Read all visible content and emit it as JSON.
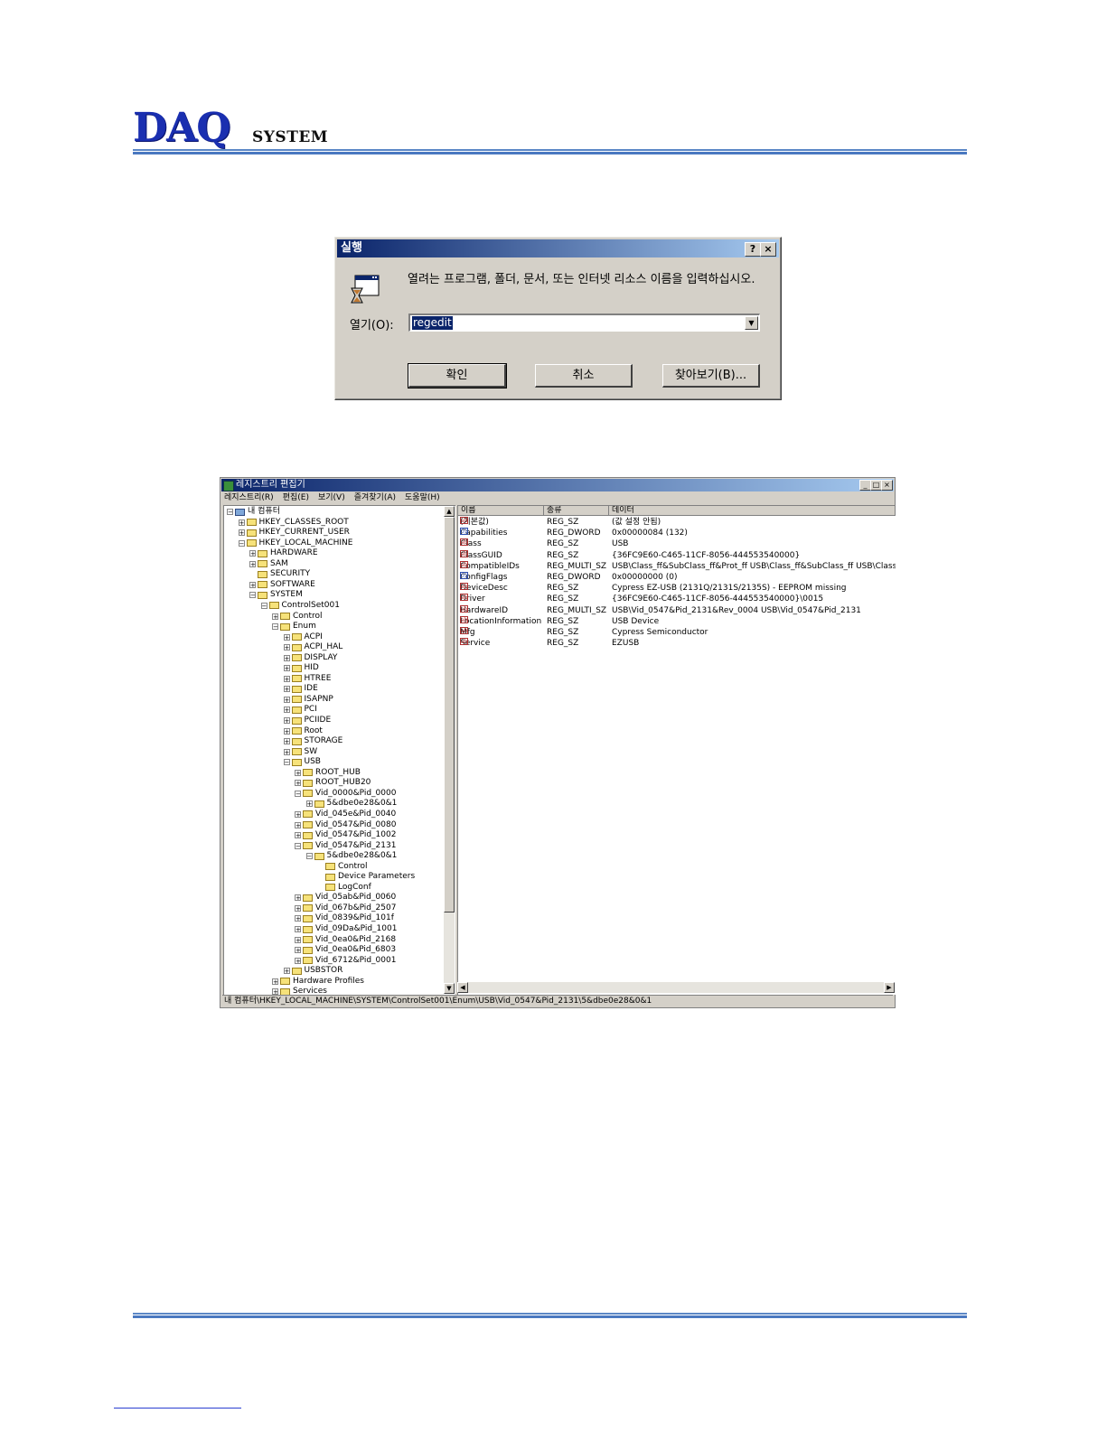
{
  "header": {
    "logo_main": "DAQ",
    "logo_sub": "SYSTEM",
    "colors": {
      "brand": "#1a2fb0",
      "rule": "#4a78c0"
    }
  },
  "run_dialog": {
    "title": "실행",
    "help_button": "?",
    "close_button": "×",
    "icon": "run-program-icon",
    "description": "열려는 프로그램, 폴더, 문서, 또는 인터넷 리소스 이름을 입력하십시오.",
    "open_label": "열기(O):",
    "input_value": "regedit",
    "ok_label": "확인",
    "cancel_label": "취소",
    "browse_label": "찾아보기(B)..."
  },
  "regedit": {
    "title": "레지스트리 편집기",
    "menu": [
      "레지스트리(R)",
      "편집(E)",
      "보기(V)",
      "즐겨찾기(A)",
      "도움말(H)"
    ],
    "tree": [
      {
        "label": "내 컴퓨터",
        "level": 0,
        "expander": "-"
      },
      {
        "label": "HKEY_CLASSES_ROOT",
        "level": 1,
        "expander": "+"
      },
      {
        "label": "HKEY_CURRENT_USER",
        "level": 1,
        "expander": "+"
      },
      {
        "label": "HKEY_LOCAL_MACHINE",
        "level": 1,
        "expander": "-"
      },
      {
        "label": "HARDWARE",
        "level": 2,
        "expander": "+"
      },
      {
        "label": "SAM",
        "level": 2,
        "expander": "+"
      },
      {
        "label": "SECURITY",
        "level": 2,
        "expander": ""
      },
      {
        "label": "SOFTWARE",
        "level": 2,
        "expander": "+"
      },
      {
        "label": "SYSTEM",
        "level": 2,
        "expander": "-"
      },
      {
        "label": "ControlSet001",
        "level": 3,
        "expander": "-"
      },
      {
        "label": "Control",
        "level": 4,
        "expander": "+"
      },
      {
        "label": "Enum",
        "level": 4,
        "expander": "-"
      },
      {
        "label": "ACPI",
        "level": 5,
        "expander": "+"
      },
      {
        "label": "ACPI_HAL",
        "level": 5,
        "expander": "+"
      },
      {
        "label": "DISPLAY",
        "level": 5,
        "expander": "+"
      },
      {
        "label": "HID",
        "level": 5,
        "expander": "+"
      },
      {
        "label": "HTREE",
        "level": 5,
        "expander": "+"
      },
      {
        "label": "IDE",
        "level": 5,
        "expander": "+"
      },
      {
        "label": "ISAPNP",
        "level": 5,
        "expander": "+"
      },
      {
        "label": "PCI",
        "level": 5,
        "expander": "+"
      },
      {
        "label": "PCIIDE",
        "level": 5,
        "expander": "+"
      },
      {
        "label": "Root",
        "level": 5,
        "expander": "+"
      },
      {
        "label": "STORAGE",
        "level": 5,
        "expander": "+"
      },
      {
        "label": "SW",
        "level": 5,
        "expander": "+"
      },
      {
        "label": "USB",
        "level": 5,
        "expander": "-"
      },
      {
        "label": "ROOT_HUB",
        "level": 6,
        "expander": "+"
      },
      {
        "label": "ROOT_HUB20",
        "level": 6,
        "expander": "+"
      },
      {
        "label": "Vid_0000&Pid_0000",
        "level": 6,
        "expander": "-"
      },
      {
        "label": "5&dbe0e28&0&1",
        "level": 7,
        "expander": "+"
      },
      {
        "label": "Vid_045e&Pid_0040",
        "level": 6,
        "expander": "+"
      },
      {
        "label": "Vid_0547&Pid_0080",
        "level": 6,
        "expander": "+"
      },
      {
        "label": "Vid_0547&Pid_1002",
        "level": 6,
        "expander": "+"
      },
      {
        "label": "Vid_0547&Pid_2131",
        "level": 6,
        "expander": "-"
      },
      {
        "label": "5&dbe0e28&0&1",
        "level": 7,
        "expander": "-"
      },
      {
        "label": "Control",
        "level": 8,
        "expander": ""
      },
      {
        "label": "Device Parameters",
        "level": 8,
        "expander": ""
      },
      {
        "label": "LogConf",
        "level": 8,
        "expander": ""
      },
      {
        "label": "Vid_05ab&Pid_0060",
        "level": 6,
        "expander": "+"
      },
      {
        "label": "Vid_067b&Pid_2507",
        "level": 6,
        "expander": "+"
      },
      {
        "label": "Vid_0839&Pid_101f",
        "level": 6,
        "expander": "+"
      },
      {
        "label": "Vid_09Da&Pid_1001",
        "level": 6,
        "expander": "+"
      },
      {
        "label": "Vid_0ea0&Pid_2168",
        "level": 6,
        "expander": "+"
      },
      {
        "label": "Vid_0ea0&Pid_6803",
        "level": 6,
        "expander": "+"
      },
      {
        "label": "Vid_6712&Pid_0001",
        "level": 6,
        "expander": "+"
      },
      {
        "label": "USBSTOR",
        "level": 5,
        "expander": "+"
      },
      {
        "label": "Hardware Profiles",
        "level": 4,
        "expander": "+"
      },
      {
        "label": "Services",
        "level": 4,
        "expander": "+"
      }
    ],
    "columns": [
      "이름",
      "종류",
      "데이터"
    ],
    "values": [
      {
        "name": "(기본값)",
        "type": "REG_SZ",
        "data": "(값 설정 안됨)",
        "icon": "string"
      },
      {
        "name": "Capabilities",
        "type": "REG_DWORD",
        "data": "0x00000084 (132)",
        "icon": "binary"
      },
      {
        "name": "Class",
        "type": "REG_SZ",
        "data": "USB",
        "icon": "string"
      },
      {
        "name": "ClassGUID",
        "type": "REG_SZ",
        "data": "{36FC9E60-C465-11CF-8056-444553540000}",
        "icon": "string"
      },
      {
        "name": "CompatibleIDs",
        "type": "REG_MULTI_SZ",
        "data": "USB\\Class_ff&SubClass_ff&Prot_ff USB\\Class_ff&SubClass_ff USB\\Class_ff",
        "icon": "string"
      },
      {
        "name": "ConfigFlags",
        "type": "REG_DWORD",
        "data": "0x00000000 (0)",
        "icon": "binary"
      },
      {
        "name": "DeviceDesc",
        "type": "REG_SZ",
        "data": "Cypress EZ-USB (2131Q/2131S/2135S) - EEPROM missing",
        "icon": "string"
      },
      {
        "name": "Driver",
        "type": "REG_SZ",
        "data": "{36FC9E60-C465-11CF-8056-444553540000}\\0015",
        "icon": "string"
      },
      {
        "name": "HardwareID",
        "type": "REG_MULTI_SZ",
        "data": "USB\\Vid_0547&Pid_2131&Rev_0004 USB\\Vid_0547&Pid_2131",
        "icon": "string"
      },
      {
        "name": "LocationInformation",
        "type": "REG_SZ",
        "data": "USB Device",
        "icon": "string"
      },
      {
        "name": "Mfg",
        "type": "REG_SZ",
        "data": "Cypress Semiconductor",
        "icon": "string"
      },
      {
        "name": "Service",
        "type": "REG_SZ",
        "data": "EZUSB",
        "icon": "string"
      }
    ],
    "status": "내 컴퓨터\\HKEY_LOCAL_MACHINE\\SYSTEM\\ControlSet001\\Enum\\USB\\Vid_0547&Pid_2131\\5&dbe0e28&0&1"
  }
}
